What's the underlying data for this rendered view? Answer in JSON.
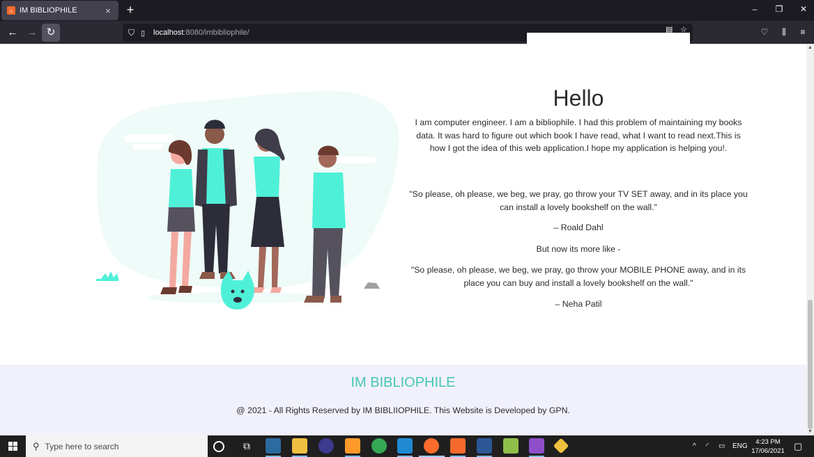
{
  "browser": {
    "tab_title": "IM BIBLIOPHILE",
    "tab_close": "×",
    "new_tab": "+",
    "url_host": "localhost",
    "url_rest": ":8080/imbibliophile/",
    "window_min": "–",
    "window_restore": "❐",
    "window_close": "✕"
  },
  "page": {
    "heading": "Hello",
    "intro": "I am computer engineer. I am a bibliophile. I had this problem of maintaining my books data. It was hard to figure out which book I have read, what I want to read next.This is how I got the idea of this web application.I hope my application is helping you!.",
    "quote1": "\"So please, oh please, we beg, we pray, go throw your TV SET away, and in its place you can install a lovely bookshelf on the wall.\"",
    "author1": "– Roald Dahl",
    "transition": "But now its more like -",
    "quote2": "\"So please, oh please, we beg, we pray, go throw your MOBILE PHONE away, and in its place you can buy and install a lovely bookshelf on the wall.\"",
    "author2": "– Neha Patil"
  },
  "footer": {
    "brand": "IM BIBLIOPHILE",
    "copyright": "@ 2021 - All Rights Reserved by IM BIBLIIOPHILE. This Website is Developed by GPN."
  },
  "taskbar": {
    "search_placeholder": "Type here to search",
    "language": "ENG",
    "time": "4:23 PM",
    "date": "17/06/2021"
  },
  "colors": {
    "accent_teal": "#45c6b3",
    "illustration_teal": "#4ff0d8",
    "footer_bg": "#f1f1fb"
  }
}
